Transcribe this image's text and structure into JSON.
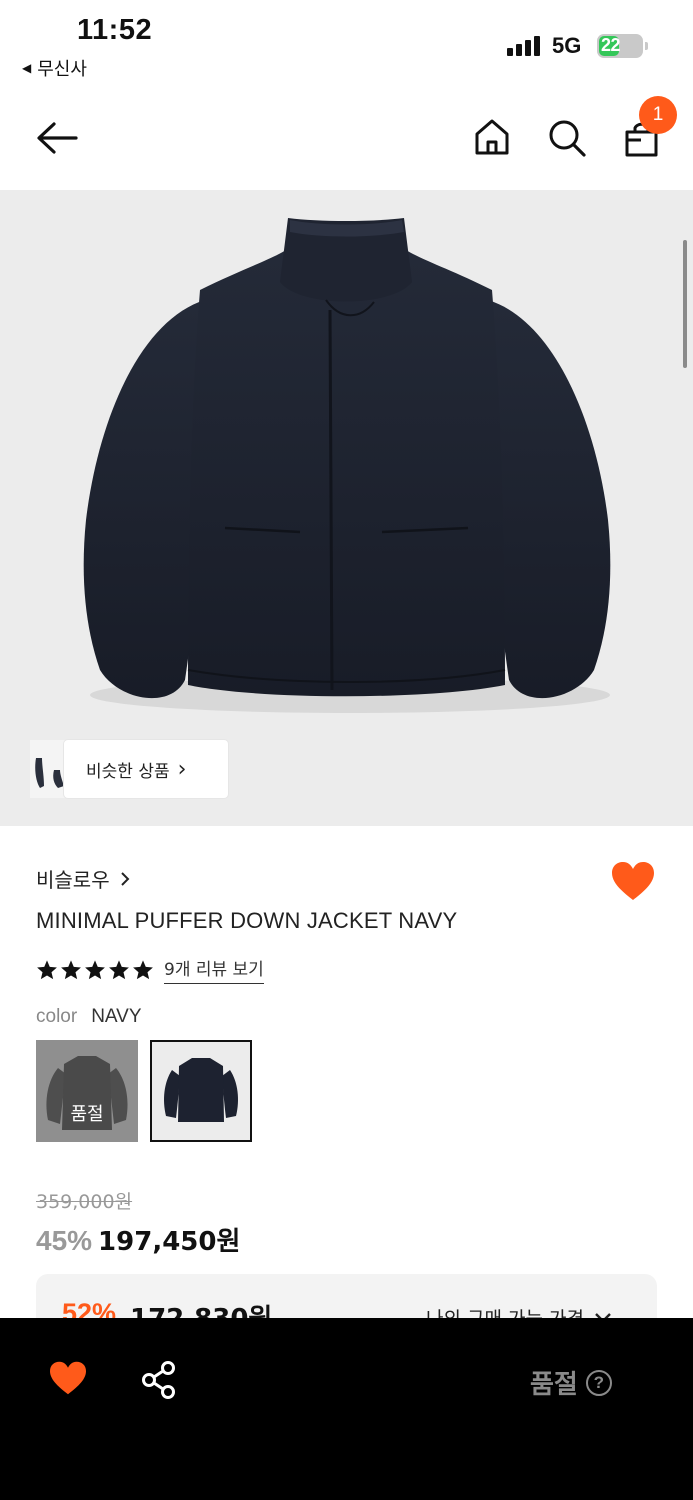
{
  "status_bar": {
    "time": "11:52",
    "back_app": "무신사",
    "network": "5G",
    "battery": "22"
  },
  "nav": {
    "icons": [
      "back-arrow-icon",
      "home-icon",
      "search-icon",
      "cart-icon"
    ],
    "cart_badge": "1"
  },
  "hero": {
    "similar_label": "비슷한 상품",
    "chevron": "›"
  },
  "product": {
    "brand": "비슬로우",
    "name": "MINIMAL PUFFER DOWN JACKET NAVY",
    "rating_stars": 5,
    "review_link": "9개 리뷰 보기",
    "color_label": "color",
    "color_value": "NAVY",
    "swatches": [
      {
        "state": "soldout",
        "label": "품절"
      },
      {
        "state": "selected"
      }
    ],
    "original_price": "359,000원",
    "discount_rate": "45%",
    "sale_price": "197,450원"
  },
  "my_price": {
    "rate": "52%",
    "price": "172,830원",
    "label": "나의 구매 가능 가격"
  },
  "bottom_bar": {
    "soldout_label": "품절",
    "help": "?"
  },
  "colors": {
    "accent": "#ff5a1a",
    "jacket": "#1d2230",
    "bottom_bar": "#000000"
  }
}
